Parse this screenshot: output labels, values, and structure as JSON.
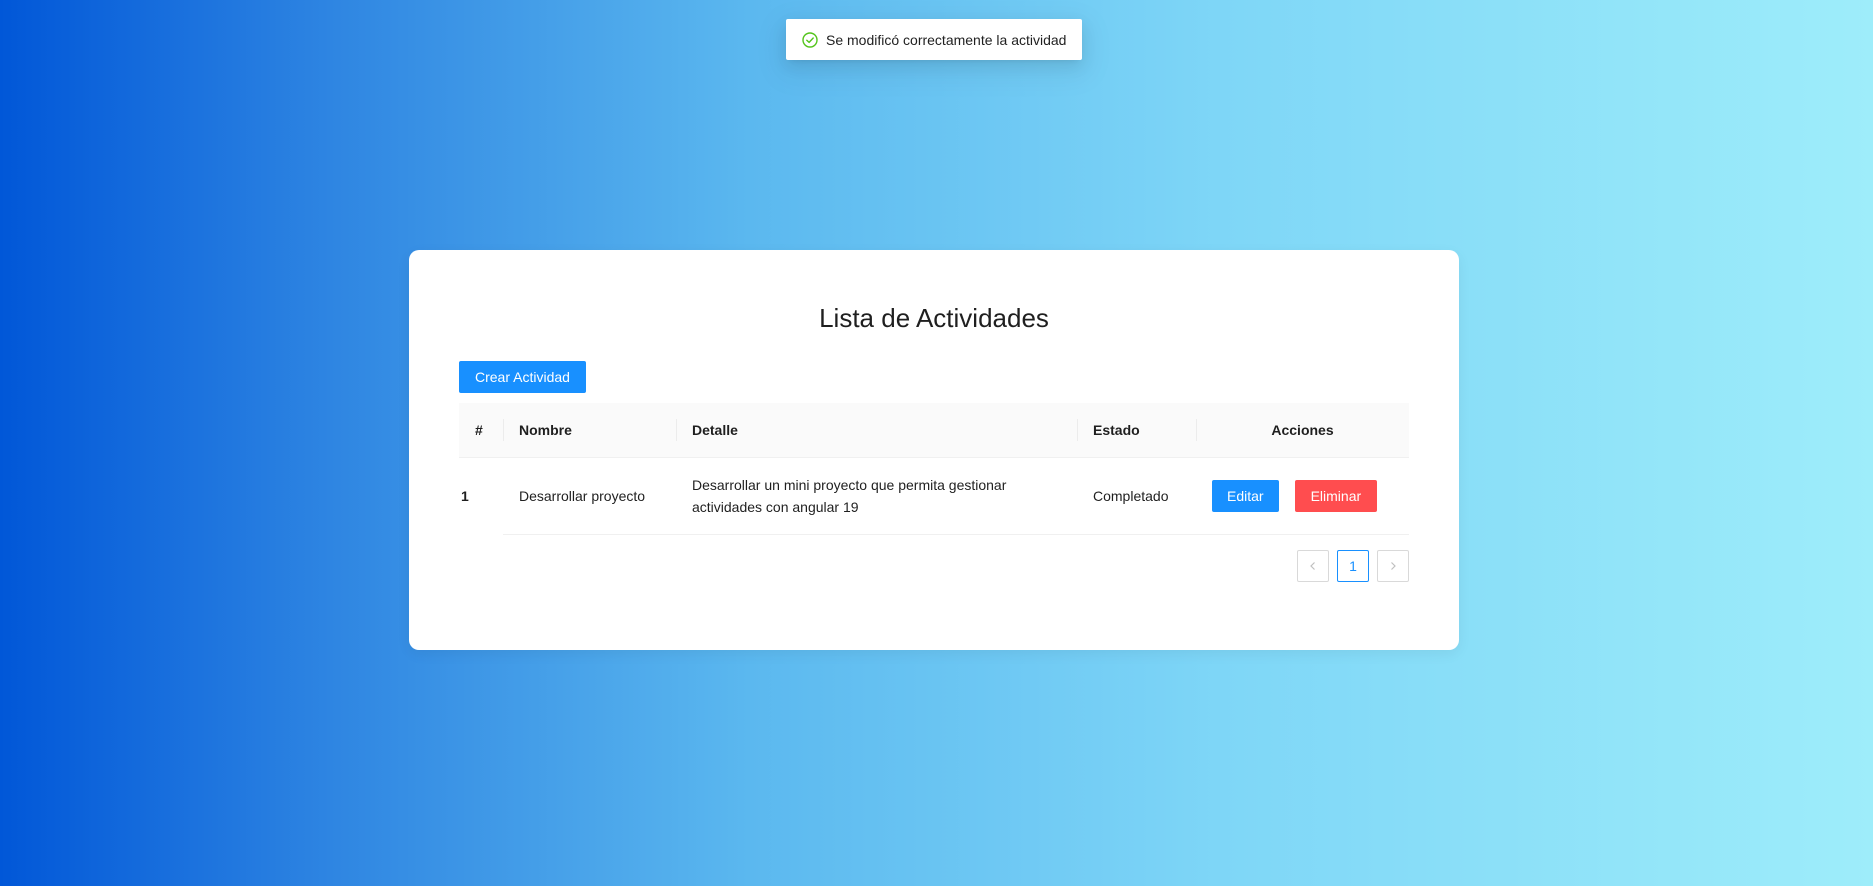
{
  "toast": {
    "icon": "check-circle-icon",
    "message": "Se modificó correctamente la actividad",
    "icon_color": "#52c41a"
  },
  "page": {
    "title": "Lista de Actividades",
    "create_button": "Crear Actividad"
  },
  "table": {
    "headers": {
      "index": "#",
      "name": "Nombre",
      "detail": "Detalle",
      "status": "Estado",
      "actions": "Acciones"
    },
    "rows": [
      {
        "index": "1",
        "name": "Desarrollar proyecto",
        "detail": "Desarrollar un mini proyecto que permita gestionar actividades con angular 19",
        "status": "Completado",
        "edit_label": "Editar",
        "delete_label": "Eliminar"
      }
    ]
  },
  "pagination": {
    "prev_icon": "chevron-left-icon",
    "current_page": "1",
    "next_icon": "chevron-right-icon"
  },
  "colors": {
    "primary": "#1890ff",
    "danger": "#ff4d4f",
    "gradient_start": "#0157d8",
    "gradient_end": "#9eedfa"
  }
}
